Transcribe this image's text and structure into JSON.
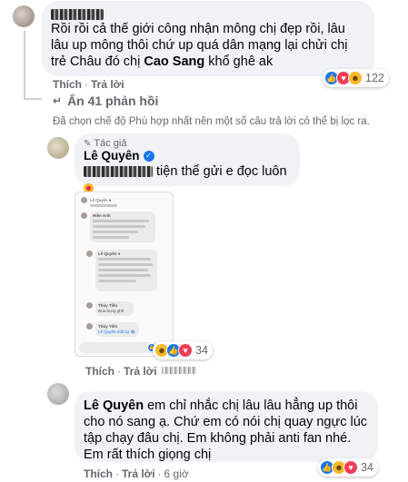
{
  "comment1": {
    "text": "Rồi rồi cả thế giới công nhận mông chị đẹp rồi, lâu lâu up mông thôi chứ up quá dân mạng lại chửi chị trẻ Châu đó chị ",
    "bold_name": "Cao Sang",
    "text_tail": " khổ ghê ak",
    "like_label": "Thích",
    "reply_label": "Trả lời",
    "reaction_count": "122"
  },
  "hide_replies": "Ẩn 41 phản hồi",
  "filter_notice": "Đã chọn chế độ Phù hợp nhất nên một số câu trả lời có thể bị lọc ra.",
  "reply1": {
    "badge": "Tác giả",
    "author": "Lê Quyên",
    "text": "tiện thể gửi e đọc luôn",
    "like_label": "Thích",
    "reply_label": "Trả lời",
    "reaction_count": "34",
    "screenshot": {
      "header_name": "Lê Quyên ●",
      "user1": "Hiền Anh",
      "msg1": "Tiện thì ng đẹp chuẩn nhưng mong c đừng chồng mông vào thời ng xem,mất thiện cảm.",
      "user2": "Lê Quyên ●",
      "msg2": "Hiền Anh ơi chụp lúc đang tập đi trên máy luôn đó chị chỉ dạy em cách đi người để quay mắt ạ",
      "user3": "Thùy Tiên",
      "msg3": "Đùa bụng ghê",
      "user4": "Thùy Tiên",
      "msg4": "Lê Quyên mất ko 😂"
    }
  },
  "reply2": {
    "bold_name": "Lê Quyên",
    "text": " em chỉ nhắc chị lâu lâu hẳng up thôi cho nó sang ạ. Chứ em có nói chị quay ngực lúc tập chạy đâu chị. Em không phải anti fan nhé. Em rất thích giọng chị",
    "like_label": "Thích",
    "reply_label": "Trả lời",
    "time": "6 giờ",
    "reaction_count": "34"
  }
}
